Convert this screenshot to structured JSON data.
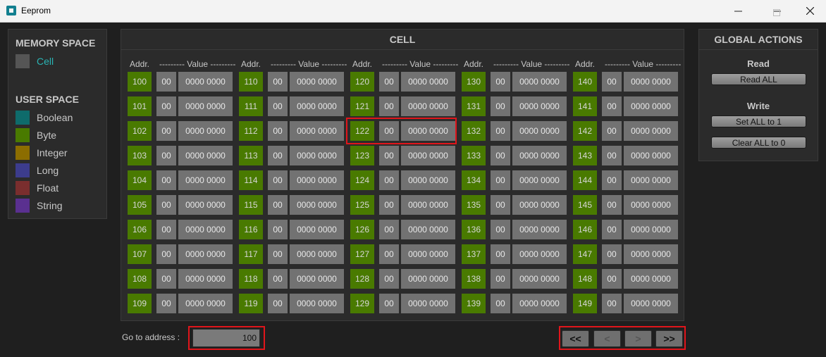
{
  "window": {
    "title": "Eeprom",
    "minimize_icon": "minimize-icon",
    "maximize_icon": "maximize-icon",
    "close_icon": "close-icon"
  },
  "memory_panel": {
    "memory_title": "MEMORY SPACE",
    "memory_items": [
      {
        "label": "Cell",
        "color": "#555555",
        "text_color": "#2ab3b3"
      }
    ],
    "user_title": "USER SPACE",
    "user_items": [
      {
        "label": "Boolean",
        "color": "#0e6b6b"
      },
      {
        "label": "Byte",
        "color": "#497a00"
      },
      {
        "label": "Integer",
        "color": "#8c6d00"
      },
      {
        "label": "Long",
        "color": "#3c3c8c"
      },
      {
        "label": "Float",
        "color": "#7a2e2e"
      },
      {
        "label": "String",
        "color": "#5a3090"
      }
    ]
  },
  "cell_panel": {
    "title": "CELL",
    "addr_header": "Addr.",
    "value_header": "--------- Value ---------",
    "columns": [
      {
        "addresses": [
          "100",
          "101",
          "102",
          "103",
          "104",
          "105",
          "106",
          "107",
          "108",
          "109"
        ]
      },
      {
        "addresses": [
          "110",
          "111",
          "112",
          "113",
          "114",
          "115",
          "116",
          "117",
          "118",
          "119"
        ]
      },
      {
        "addresses": [
          "120",
          "121",
          "122",
          "123",
          "124",
          "125",
          "126",
          "127",
          "128",
          "129"
        ]
      },
      {
        "addresses": [
          "130",
          "131",
          "132",
          "133",
          "134",
          "135",
          "136",
          "137",
          "138",
          "139"
        ]
      },
      {
        "addresses": [
          "140",
          "141",
          "142",
          "143",
          "144",
          "145",
          "146",
          "147",
          "148",
          "149"
        ]
      }
    ],
    "hex_value": "00",
    "bin_value": "0000 0000",
    "highlighted_address": "122"
  },
  "global_actions": {
    "title": "GLOBAL ACTIONS",
    "read_label": "Read",
    "read_all": "Read ALL",
    "write_label": "Write",
    "set_all": "Set ALL to 1",
    "clear_all": "Clear ALL to 0"
  },
  "navigation": {
    "goto_label": "Go to address :",
    "goto_value": "100",
    "first": "<<",
    "prev": "<",
    "next": ">",
    "last": ">>"
  },
  "colors": {
    "highlight": "#e0151b",
    "addr_bg": "#497a00",
    "value_bg": "#727272"
  }
}
